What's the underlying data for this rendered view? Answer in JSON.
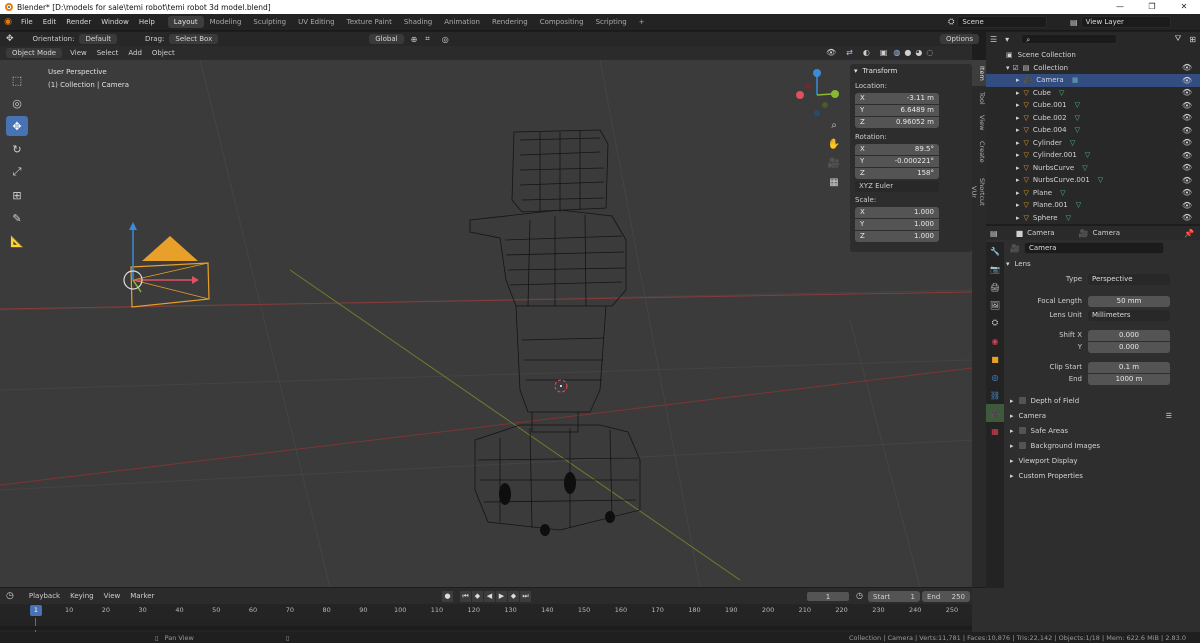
{
  "window": {
    "title": "Blender* [D:\\models for sale\\temi robot\\temi robot 3d model.blend]",
    "controls": [
      "—",
      "❐",
      "✕"
    ]
  },
  "menu": [
    "File",
    "Edit",
    "Render",
    "Window",
    "Help"
  ],
  "workspaces": [
    "Layout",
    "Modeling",
    "Sculpting",
    "UV Editing",
    "Texture Paint",
    "Shading",
    "Animation",
    "Rendering",
    "Compositing",
    "Scripting"
  ],
  "workspace_add": "+",
  "scene": {
    "label": "Scene",
    "view_layer": "View Layer"
  },
  "viewport_header": {
    "orientation_label": "Orientation:",
    "orientation_value": "Default",
    "drag_label": "Drag:",
    "drag_value": "Select Box",
    "transform_space": "Global",
    "options": "Options",
    "mode": "Object Mode",
    "menus": [
      "View",
      "Select",
      "Add",
      "Object"
    ]
  },
  "viewport": {
    "perspective": "User Perspective",
    "collection_info": "(1) Collection | Camera"
  },
  "n_panel": {
    "title": "Transform",
    "tabs": [
      "Item",
      "Tool",
      "View",
      "Create",
      "Shortcut VUr"
    ],
    "location_label": "Location:",
    "location": [
      {
        "axis": "X",
        "value": "-3.11 m"
      },
      {
        "axis": "Y",
        "value": "6.6489 m"
      },
      {
        "axis": "Z",
        "value": "0.96052 m"
      }
    ],
    "rotation_label": "Rotation:",
    "rotation": [
      {
        "axis": "X",
        "value": "89.5°"
      },
      {
        "axis": "Y",
        "value": "-0.000221°"
      },
      {
        "axis": "Z",
        "value": "158°"
      }
    ],
    "rotation_mode": "XYZ Euler",
    "scale_label": "Scale:",
    "scale": [
      {
        "axis": "X",
        "value": "1.000"
      },
      {
        "axis": "Y",
        "value": "1.000"
      },
      {
        "axis": "Z",
        "value": "1.000"
      }
    ]
  },
  "outliner": {
    "root": "Scene Collection",
    "collection": "Collection",
    "items": [
      "Camera",
      "Cube",
      "Cube.001",
      "Cube.002",
      "Cube.004",
      "Cylinder",
      "Cylinder.001",
      "NurbsCurve",
      "NurbsCurve.001",
      "Plane",
      "Plane.001",
      "Sphere"
    ],
    "selected": "Camera"
  },
  "properties": {
    "breadcrumb_object": "Camera",
    "breadcrumb_data": "Camera",
    "datablock": "Camera",
    "lens_section": "Lens",
    "type_label": "Type",
    "type_value": "Perspective",
    "focal_label": "Focal Length",
    "focal_value": "50 mm",
    "lens_unit_label": "Lens Unit",
    "lens_unit_value": "Millimeters",
    "shift_x_label": "Shift X",
    "shift_x_value": "0.000",
    "shift_y_label": "Y",
    "shift_y_value": "0.000",
    "clip_start_label": "Clip Start",
    "clip_start_value": "0.1 m",
    "clip_end_label": "End",
    "clip_end_value": "1000 m",
    "sections": [
      "Depth of Field",
      "Camera",
      "Safe Areas",
      "Background Images",
      "Viewport Display",
      "Custom Properties"
    ]
  },
  "timeline": {
    "menus": [
      "Playback",
      "Keying",
      "View",
      "Marker"
    ],
    "current_frame": "1",
    "start_label": "Start",
    "start": "1",
    "end_label": "End",
    "end": "250",
    "ruler": [
      "1",
      "10",
      "20",
      "30",
      "40",
      "50",
      "60",
      "70",
      "80",
      "90",
      "100",
      "110",
      "120",
      "130",
      "140",
      "150",
      "160",
      "170",
      "180",
      "190",
      "200",
      "210",
      "220",
      "230",
      "240",
      "250"
    ]
  },
  "status": {
    "left": "Pan View",
    "right": "Collection | Camera | Verts:11,781 | Faces:10,876 | Tris:22,142 | Objects:1/18 | Mem: 622.6 MiB | 2.83.0"
  },
  "colors": {
    "accent": "#4772b3",
    "selection": "#334d80",
    "camera_orange": "#e8a02a",
    "x_axis": "#d24a54",
    "y_axis": "#8ab832",
    "z_axis": "#3c8bd6"
  }
}
